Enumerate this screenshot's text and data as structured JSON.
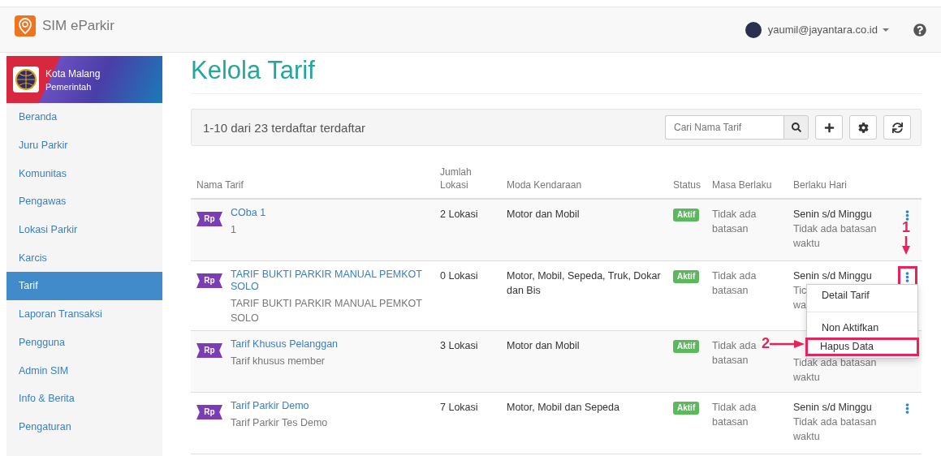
{
  "header": {
    "app_name": "SIM eParkir",
    "user_email": "yaumil@jayantara.co.id"
  },
  "sidebar": {
    "org_name": "Kota Malang",
    "org_type": "Pemerintah",
    "items": [
      {
        "label": "Beranda",
        "selected": false
      },
      {
        "label": "Juru Parkir",
        "selected": false
      },
      {
        "label": "Komunitas",
        "selected": false
      },
      {
        "label": "Pengawas",
        "selected": false
      },
      {
        "label": "Lokasi Parkir",
        "selected": false
      },
      {
        "label": "Karcis",
        "selected": false
      },
      {
        "label": "Tarif",
        "selected": true
      },
      {
        "label": "Laporan Transaksi",
        "selected": false
      },
      {
        "label": "Pengguna",
        "selected": false
      },
      {
        "label": "Admin SIM",
        "selected": false
      },
      {
        "label": "Info & Berita",
        "selected": false
      },
      {
        "label": "Pengaturan",
        "selected": false
      }
    ]
  },
  "page_title": "Kelola Tarif",
  "toolbar": {
    "summary": "1-10 dari 23 terdaftar terdaftar",
    "search": {
      "placeholder": "Cari Nama Tarif"
    }
  },
  "table": {
    "columns": [
      "Nama Tarif",
      "Jumlah Lokasi",
      "Moda Kendaraan",
      "Status",
      "Masa Berlaku",
      "Berlaku Hari"
    ],
    "rows": [
      {
        "icon_label": "Rp",
        "name": "COba 1",
        "description": "1",
        "locations": "2 Lokasi",
        "vehicles": "Motor dan Mobil",
        "status": "Aktif",
        "period": "Tidak ada batasan",
        "days": "Senin s/d Minggu",
        "time": [
          "Tidak ada batasan",
          "waktu"
        ],
        "menu_marked": false,
        "menu_open": false
      },
      {
        "icon_label": "Rp",
        "name": "TARIF BUKTI PARKIR MANUAL PEMKOT SOLO",
        "description": "TARIF BUKTI PARKIR MANUAL PEMKOT SOLO",
        "locations": "0 Lokasi",
        "vehicles": "Motor, Mobil, Sepeda, Truk, Dokar dan Bis",
        "status": "Aktif",
        "period": "Tidak ada batasan",
        "days": "Senin s/d Minggu",
        "time": [
          "Tic",
          "wa"
        ],
        "menu_marked": true,
        "menu_open": true
      },
      {
        "icon_label": "Rp",
        "name": "Tarif Khusus Pelanggan",
        "description": "Tarif khusus member",
        "locations": "3 Lokasi",
        "vehicles": "Motor dan Mobil",
        "status": "Aktif",
        "period": "Tidak ada batasan",
        "time": [
          "Tidak ada batasan",
          "waktu"
        ]
      },
      {
        "icon_label": "Rp",
        "name": "Tarif Parkir Demo",
        "description": "Tarif Parkir Tes Demo",
        "locations": "7 Lokasi",
        "vehicles": "Motor, Mobil dan Sepeda",
        "status": "Aktif",
        "period": "Tidak ada batasan",
        "days": "Senin s/d Minggu",
        "time": [
          "Tidak ada batasan",
          "waktu"
        ],
        "menu_marked": false,
        "menu_open": false
      }
    ]
  },
  "row_menu": {
    "items": [
      {
        "label": "Detail Tarif",
        "marked": false
      },
      {
        "label": "Non Aktifkan",
        "marked": false
      },
      {
        "label": "Hapus Data",
        "marked": true
      }
    ]
  },
  "annotations": [
    {
      "label": "1",
      "kind": "down"
    },
    {
      "label": "2",
      "kind": "right"
    }
  ]
}
